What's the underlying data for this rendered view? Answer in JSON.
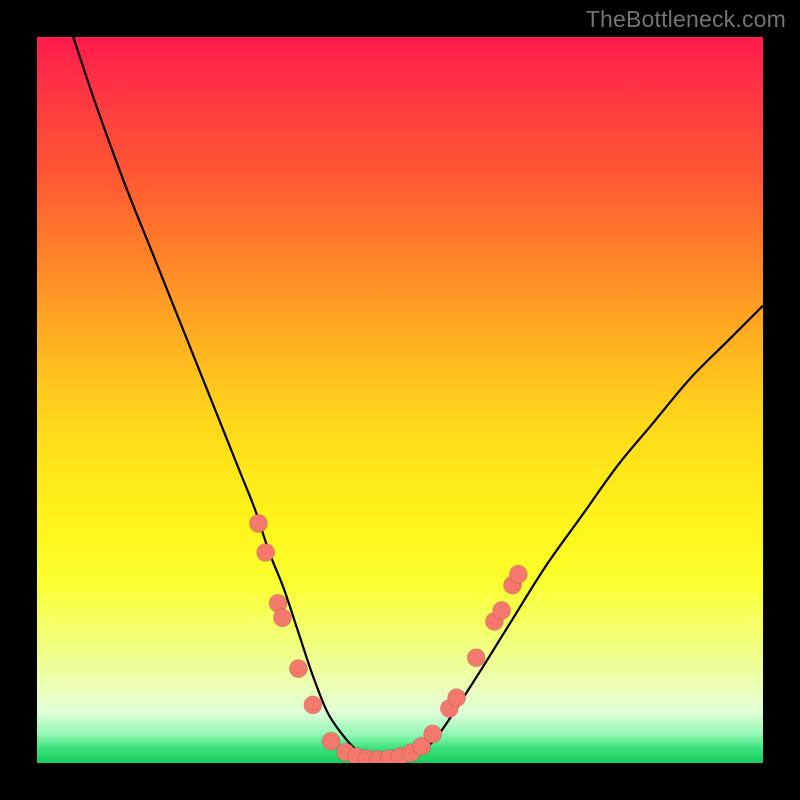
{
  "watermark": "TheBottleneck.com",
  "colors": {
    "frame": "#000000",
    "dot": "#f4796c",
    "curve": "#000000"
  },
  "chart_data": {
    "type": "line",
    "title": "",
    "xlabel": "",
    "ylabel": "",
    "xlim": [
      0,
      100
    ],
    "ylim": [
      0,
      100
    ],
    "grid": false,
    "legend": false,
    "series": [
      {
        "name": "bottleneck-curve",
        "x": [
          5,
          8,
          12,
          16,
          20,
          24,
          28,
          30,
          32,
          34,
          36,
          38,
          40,
          42,
          44,
          46,
          48,
          50,
          52,
          55,
          60,
          65,
          70,
          75,
          80,
          85,
          90,
          95,
          100
        ],
        "y": [
          100,
          91,
          80,
          70,
          60,
          50,
          40,
          35,
          29,
          24,
          18,
          12,
          7,
          4,
          1.8,
          0.8,
          0.5,
          0.6,
          1.2,
          3.5,
          11,
          19,
          27,
          34,
          41,
          47,
          53,
          58,
          63
        ]
      }
    ],
    "markers": [
      {
        "x": 30.5,
        "y": 33
      },
      {
        "x": 31.5,
        "y": 29
      },
      {
        "x": 33.2,
        "y": 22
      },
      {
        "x": 33.8,
        "y": 20
      },
      {
        "x": 36.0,
        "y": 13
      },
      {
        "x": 38.0,
        "y": 8
      },
      {
        "x": 40.5,
        "y": 3
      },
      {
        "x": 42.5,
        "y": 1.5
      },
      {
        "x": 44.0,
        "y": 0.9
      },
      {
        "x": 45.5,
        "y": 0.6
      },
      {
        "x": 47.0,
        "y": 0.5
      },
      {
        "x": 48.5,
        "y": 0.6
      },
      {
        "x": 50.0,
        "y": 0.9
      },
      {
        "x": 51.5,
        "y": 1.4
      },
      {
        "x": 53.0,
        "y": 2.3
      },
      {
        "x": 54.5,
        "y": 4.0
      },
      {
        "x": 56.8,
        "y": 7.5
      },
      {
        "x": 57.8,
        "y": 9.0
      },
      {
        "x": 60.5,
        "y": 14.5
      },
      {
        "x": 63.0,
        "y": 19.5
      },
      {
        "x": 64.0,
        "y": 21
      },
      {
        "x": 65.5,
        "y": 24.5
      },
      {
        "x": 66.3,
        "y": 26
      }
    ]
  }
}
